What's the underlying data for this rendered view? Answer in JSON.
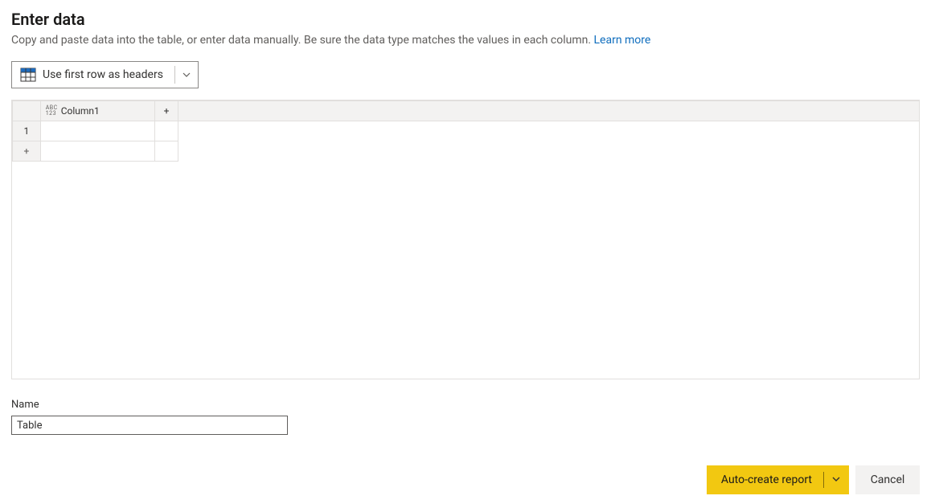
{
  "header": {
    "title": "Enter data",
    "subtitle_prefix": "Copy and paste data into the table, or enter data manually. Be sure the data type matches the values in each column. ",
    "learn_more": "Learn more"
  },
  "toolbar": {
    "first_row_as_headers": "Use first row as headers"
  },
  "grid": {
    "column_header": "Column1",
    "type_icon_top": "ABC",
    "type_icon_bottom": "123",
    "row1_index": "1",
    "add_row": "+",
    "add_column": "+",
    "row1_value": ""
  },
  "name": {
    "label": "Name",
    "value": "Table"
  },
  "footer": {
    "auto_create": "Auto-create report",
    "cancel": "Cancel"
  }
}
